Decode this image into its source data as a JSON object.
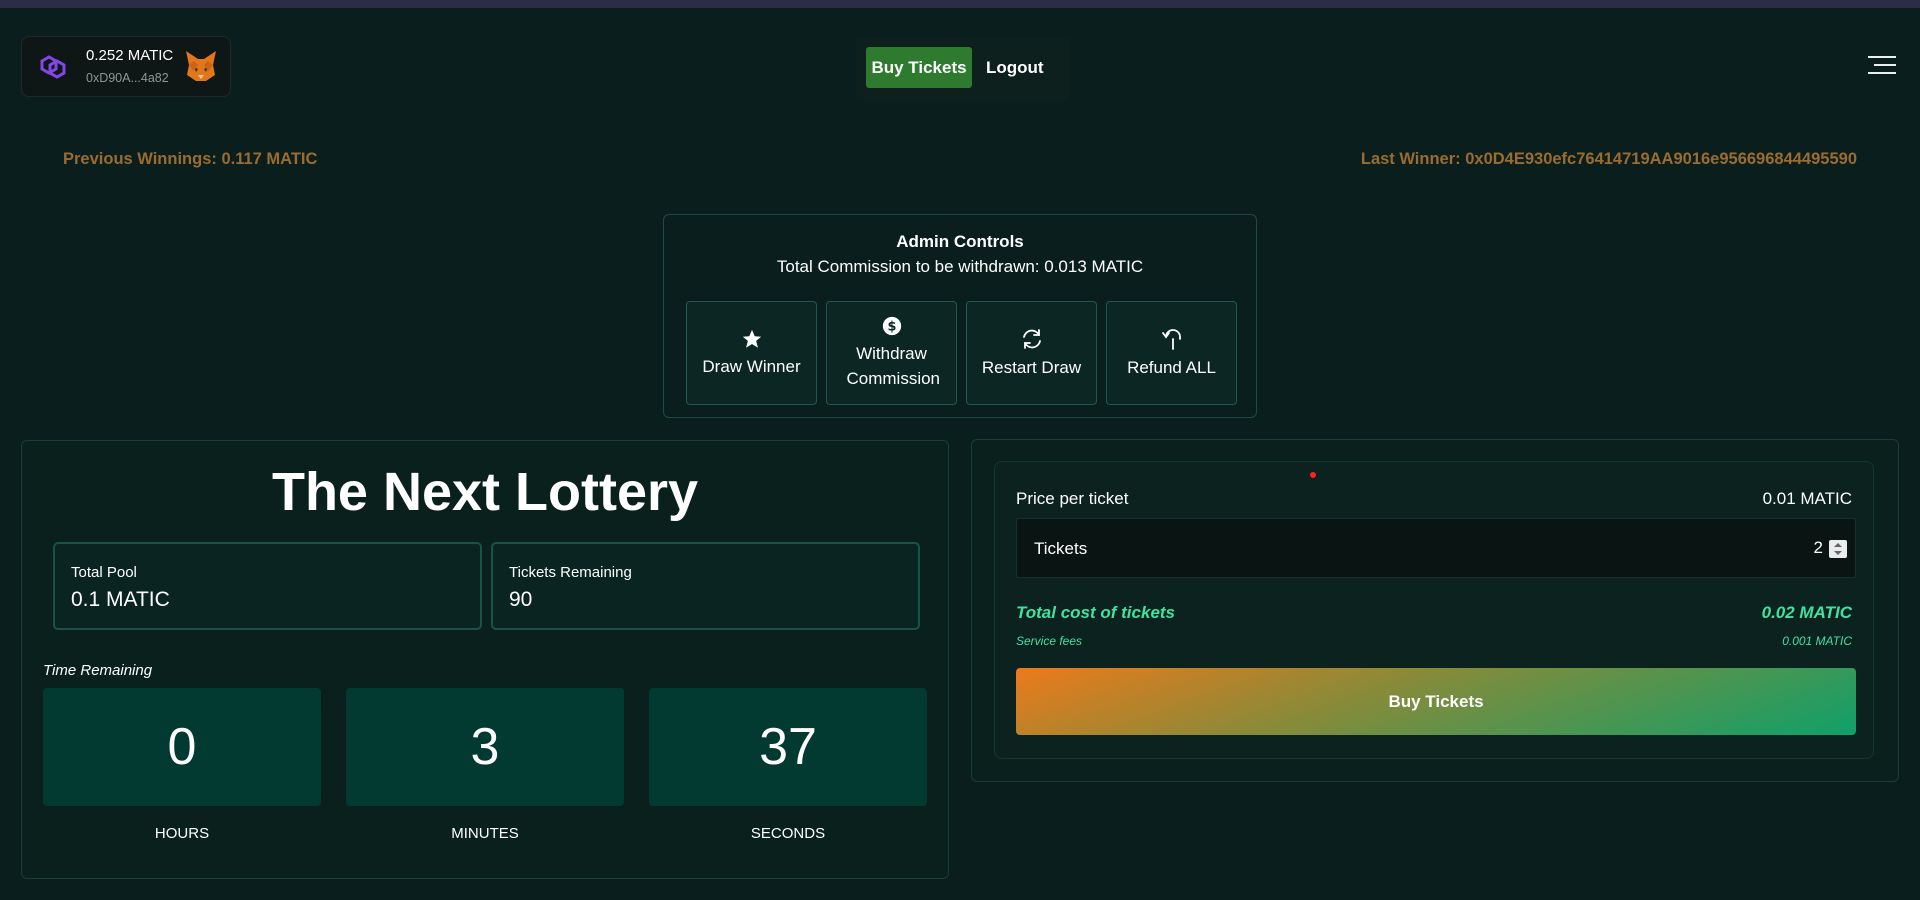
{
  "wallet": {
    "balance": "0.252 MATIC",
    "address": "0xD90A...4a82",
    "network_icon": "polygon-icon",
    "wallet_icon": "metamask-fox-icon"
  },
  "nav": {
    "buy_tickets": "Buy Tickets",
    "logout": "Logout",
    "menu_icon": "hamburger-menu-icon"
  },
  "banner": {
    "previous_winnings": "Previous Winnings: 0.117 MATIC",
    "last_winner": "Last Winner: 0x0D4E930efc76414719AA9016e956696844495590"
  },
  "admin": {
    "title": "Admin Controls",
    "commission": "Total Commission to be withdrawn: 0.013 MATIC",
    "buttons": [
      {
        "label": "Draw Winner",
        "icon": "star-icon"
      },
      {
        "label": "Withdraw Commission",
        "icon": "dollar-coin-icon"
      },
      {
        "label": "Restart Draw",
        "icon": "refresh-icon"
      },
      {
        "label": "Refund ALL",
        "icon": "refund-arrow-icon"
      }
    ]
  },
  "lottery": {
    "heading": "The Next Lottery",
    "total_pool_label": "Total Pool",
    "total_pool_value": "0.1 MATIC",
    "tickets_remaining_label": "Tickets Remaining",
    "tickets_remaining_value": "90",
    "time_remaining_label": "Time Remaining",
    "countdown": [
      {
        "value": "0",
        "unit": "HOURS"
      },
      {
        "value": "3",
        "unit": "MINUTES"
      },
      {
        "value": "37",
        "unit": "SECONDS"
      }
    ]
  },
  "purchase": {
    "price_label": "Price per ticket",
    "price_value": "0.01 MATIC",
    "tickets_label": "Tickets",
    "tickets_value": "2",
    "total_label": "Total cost of tickets",
    "total_value": "0.02 MATIC",
    "fee_label": "Service fees",
    "fee_value": "0.001 MATIC",
    "buy_button": "Buy Tickets"
  },
  "colors": {
    "background": "#0a1f1d",
    "accent_gold": "#9b6b2f",
    "accent_green": "#3fe3a0",
    "nav_button": "#2e7a2e",
    "timer_box": "#023a31"
  }
}
